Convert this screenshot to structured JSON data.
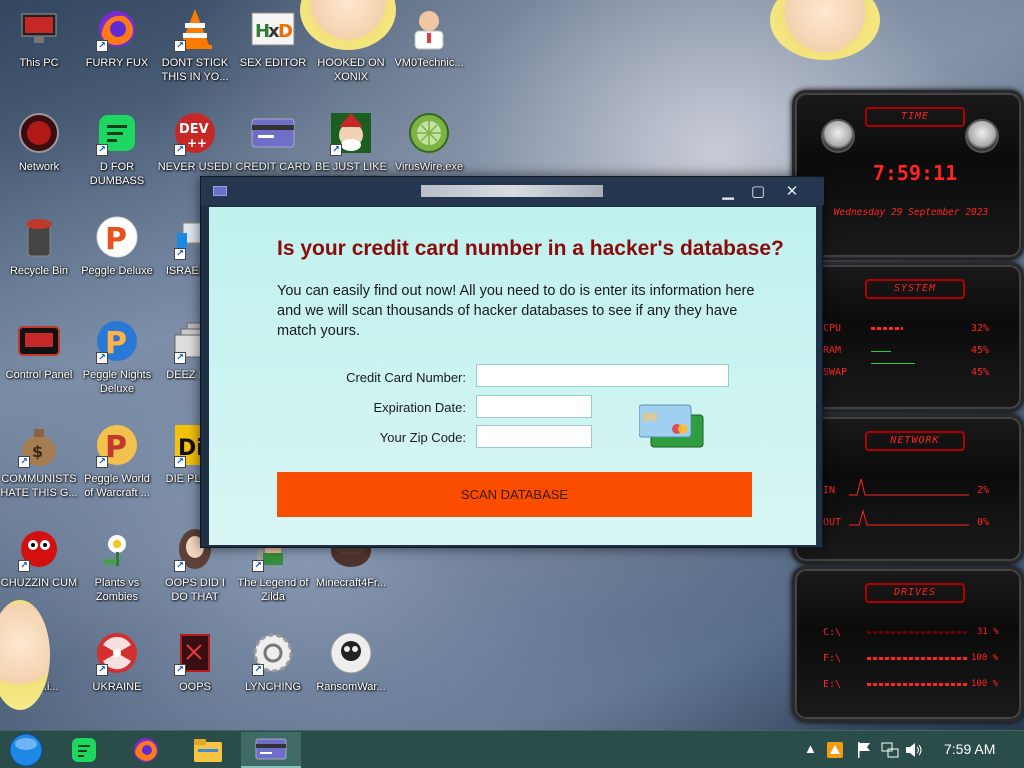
{
  "desktop": {
    "icons": [
      {
        "label": "This PC"
      },
      {
        "label": "FURRY FUX"
      },
      {
        "label": "DONT STICK THIS IN YO..."
      },
      {
        "label": "SEX EDITOR"
      },
      {
        "label": "HOOKED ON XONIX"
      },
      {
        "label": "VM0Technic..."
      },
      {
        "label": "Network"
      },
      {
        "label": "D FOR DUMBASS"
      },
      {
        "label": "NEVER USED!"
      },
      {
        "label": "CREDIT CARD CHECKER"
      },
      {
        "label": "BE JUST LIKE THE DUDE!"
      },
      {
        "label": "VirusWire.exe"
      },
      {
        "label": "Recycle Bin"
      },
      {
        "label": "Peggle Deluxe"
      },
      {
        "label": "ISRAEL S..."
      },
      {
        "label": "Control Panel"
      },
      {
        "label": "Peggle Nights Deluxe"
      },
      {
        "label": "DEEZ NU..."
      },
      {
        "label": "COMMUNISTS HATE THIS G..."
      },
      {
        "label": "Peggle World of Warcraft ..."
      },
      {
        "label": "DIE PLEA..."
      },
      {
        "label": "CHUZZIN CUM"
      },
      {
        "label": "Plants vs Zombies"
      },
      {
        "label": "OOPS DID I DO THAT"
      },
      {
        "label": "The Legend of Zilda"
      },
      {
        "label": "Minecraft4Fr..."
      },
      {
        "label": "...d ...i..."
      },
      {
        "label": "UKRAINE"
      },
      {
        "label": "OOPS"
      },
      {
        "label": "LYNCHING"
      },
      {
        "label": "RansomWar..."
      }
    ],
    "icon_text": {
      "dev": "DEV",
      "dev_sub": "++",
      "peggle": "P",
      "die": "Die"
    }
  },
  "window": {
    "title": "",
    "minimize": "▁",
    "maximize": "▢",
    "close": "✕",
    "heading": "Is your credit card number in a hacker's database?",
    "description": "You can easily find out now! All you need to do is enter its information here and we will scan thousands of hacker databases to see if any they have match yours.",
    "fields": {
      "card_label": "Credit Card Number:",
      "card_value": "",
      "exp_label": "Expiration Date:",
      "exp_value": "",
      "zip_label": "Your Zip Code:",
      "zip_value": ""
    },
    "scan_button": "SCAN DATABASE"
  },
  "gadget": {
    "time_header": "TIME",
    "time": "7:59:11",
    "date": "Wednesday 29 September 2023",
    "system_header": "SYSTEM",
    "cpu_label": "CPU",
    "cpu_value": "32%",
    "ram_label": "RAM",
    "ram_value": "45%",
    "swap_label": "SWAP",
    "swap_value": "45%",
    "network_header": "NETWORK",
    "in_label": "IN",
    "in_value": "2%",
    "out_label": "OUT",
    "out_value": "0%",
    "drives_header": "DRIVES",
    "drive_c_label": "C:\\",
    "drive_c_value": "31 %",
    "drive_f_label": "F:\\",
    "drive_f_value": "100 %",
    "drive_e_label": "E:\\",
    "drive_e_value": "100 %"
  },
  "taskbar": {
    "clock": "7:59 AM"
  },
  "colors": {
    "accent_red": "#ff2323",
    "scan_button": "#fb4d00",
    "heading": "#8b0a0a",
    "taskbar": "#2a4d4a"
  }
}
